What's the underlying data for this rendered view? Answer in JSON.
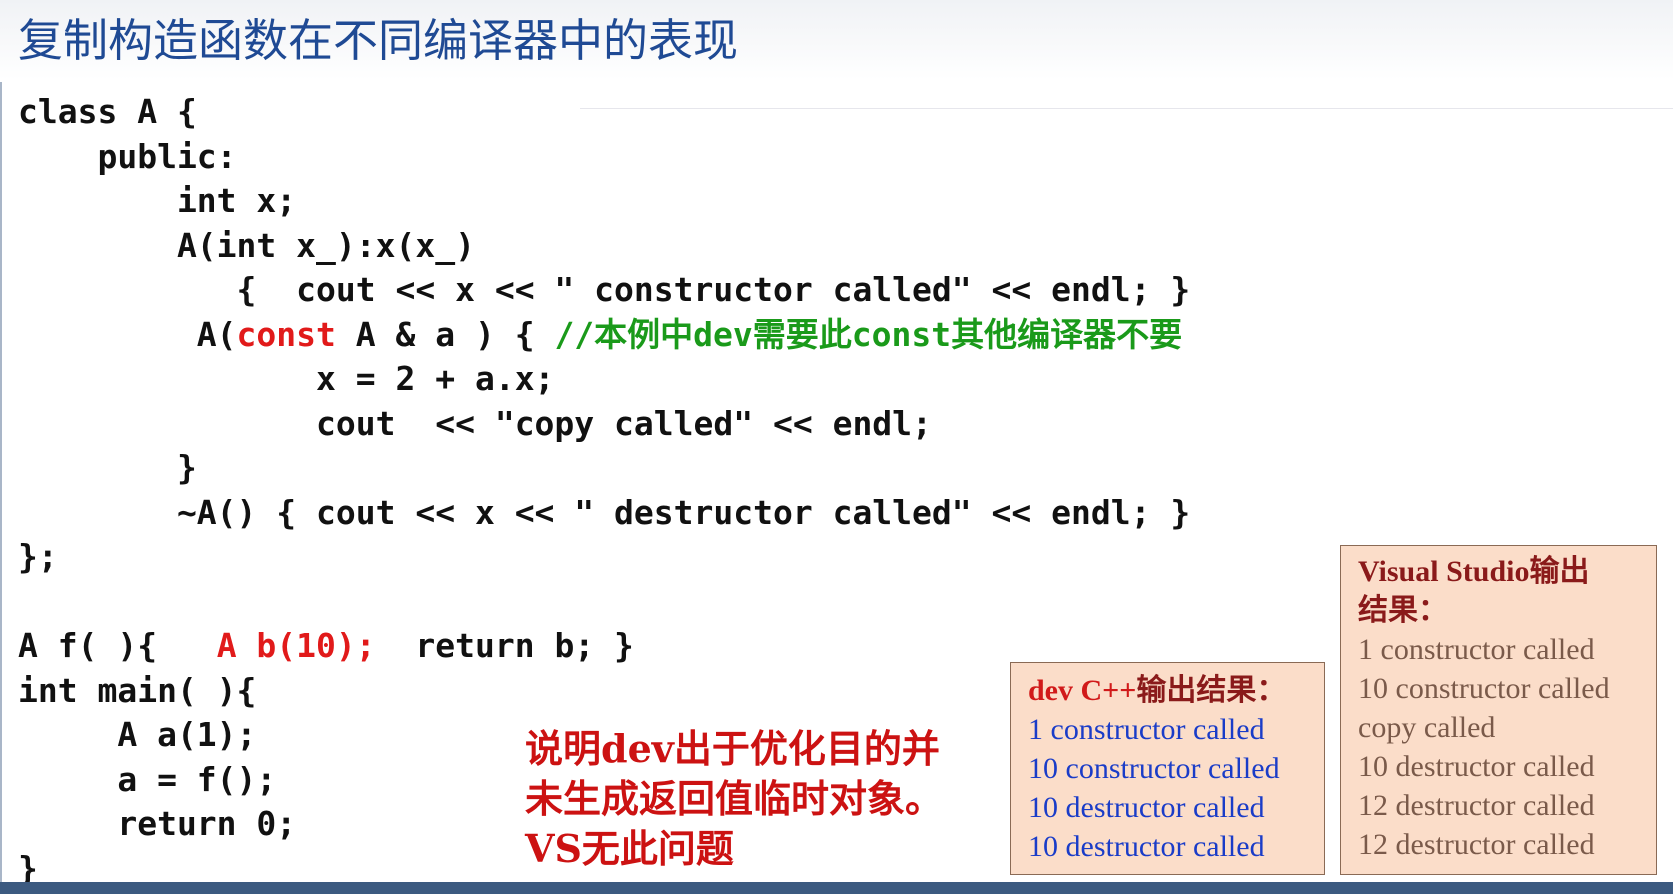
{
  "slide": {
    "title": "复制构造函数在不同编译器中的表现"
  },
  "code": {
    "line1": "class A {",
    "line2": "    public:",
    "line3": "        int x;",
    "line4": "        A(int x_):x(x_)",
    "line5": "           {  cout << x << \" constructor called\" << endl; }",
    "line6_prefix": "         A(",
    "line6_const": "const",
    "line6_middle": " A & a ) { ",
    "line6_comment": "//本例中dev需要此const其他编译器不要",
    "line7": "               x = 2 + a.x;",
    "line8": "               cout  << \"copy called\" << endl;",
    "line9": "        }",
    "line10": "        ~A() { cout << x << \" destructor called\" << endl; }",
    "line11": "};",
    "line12": "",
    "line13_prefix": "A f( ){   ",
    "line13_red": "A b(10);",
    "line13_suffix": "  return b; }",
    "line14": "int main( ){",
    "line15": "     A a(1);",
    "line16": "     a = f();",
    "line17": "     return 0;",
    "line18": "}"
  },
  "note": {
    "line1": "说明dev出于优化目的并",
    "line2": "未生成返回值临时对象。",
    "line3": "VS无此问题"
  },
  "dev_box": {
    "header_accent": "dev C++",
    "header_rest": "输出结果：",
    "items": [
      "1 constructor called",
      "10 constructor called",
      "10 destructor called",
      "10 destructor called"
    ]
  },
  "vs_box": {
    "header_line1": "Visual Studio输出",
    "header_line2": "结果：",
    "items": [
      "1 constructor called",
      "10 constructor called",
      "copy called",
      "10 destructor called",
      "12 destructor called",
      "12 destructor called"
    ]
  },
  "colors": {
    "title": "#1f4a94",
    "keyword_red": "#e11a1a",
    "comment_green": "#1a9a1a",
    "note_red": "#cc1212",
    "box_fill": "#fbddc9",
    "dev_output_blue": "#1a3cc8",
    "vs_output_brown": "#7a5a4a"
  }
}
